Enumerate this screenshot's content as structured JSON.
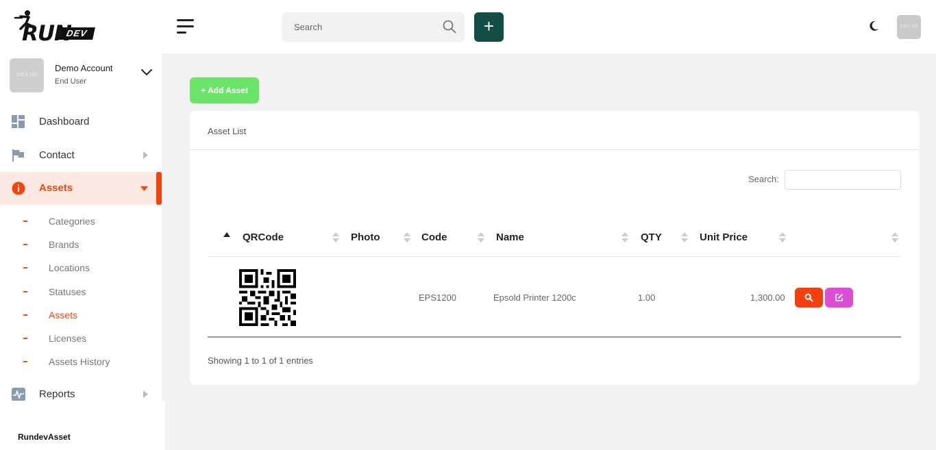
{
  "brand": {
    "logo_text": "RUN",
    "logo_suffix": "DEV",
    "footer": "RundevAsset"
  },
  "header": {
    "search_placeholder": "Search",
    "add_button": "+",
    "avatar_text": "200 x 200"
  },
  "account": {
    "name": "Demo Account",
    "role": "End User",
    "avatar_text": "200 x 200"
  },
  "sidebar": {
    "items": [
      {
        "label": "Dashboard",
        "icon": "dashboard-icon"
      },
      {
        "label": "Contact",
        "icon": "flag-icon"
      },
      {
        "label": "Assets",
        "icon": "info-icon"
      },
      {
        "label": "Reports",
        "icon": "activity-icon"
      }
    ],
    "asset_subitems": [
      {
        "label": "Categories"
      },
      {
        "label": "Brands"
      },
      {
        "label": "Locations"
      },
      {
        "label": "Statuses"
      },
      {
        "label": "Assets"
      },
      {
        "label": "Licenses"
      },
      {
        "label": "Assets History"
      }
    ]
  },
  "main": {
    "add_button": "+ Add Asset",
    "card_title": "Asset List",
    "search_label": "Search:",
    "columns": [
      "QRCode",
      "Photo",
      "Code",
      "Name",
      "QTY",
      "Unit Price"
    ],
    "rows": [
      {
        "code": "EPS1200",
        "name": "Epsold Printer 1200c",
        "qty": "1.00",
        "unit_price": "1,300.00"
      }
    ],
    "info": "Showing 1 to 1 of 1 entries"
  },
  "colors": {
    "accent": "#f0450f",
    "dark_green": "#134e45",
    "add_green": "#6ce46a",
    "edit_pink": "#dd4ed5"
  }
}
